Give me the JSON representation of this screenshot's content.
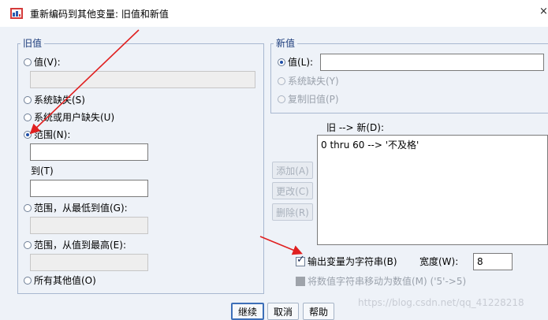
{
  "window": {
    "title": "重新编码到其他变量: 旧值和新值",
    "close_glyph": "×"
  },
  "old_value": {
    "legend": "旧值",
    "value_label": "值(V):",
    "system_missing_label": "系统缺失(S)",
    "system_or_user_missing_label": "系统或用户缺失(U)",
    "range_label": "范围(N):",
    "range_through_label": "到(T)",
    "range_lowest_label": "范围，从最低到值(G):",
    "range_highest_label": "范围，从值到最高(E):",
    "all_other_label": "所有其他值(O)",
    "selected": "range"
  },
  "new_value": {
    "legend": "新值",
    "value_label": "值(L):",
    "system_missing_label": "系统缺失(Y)",
    "copy_old_label": "复制旧值(P)",
    "selected": "value"
  },
  "mapping": {
    "header": "旧 --> 新(D):",
    "items": [
      "0 thru 60 --> '不及格'"
    ]
  },
  "side_buttons": {
    "add": "添加(A)",
    "change": "更改(C)",
    "remove": "删除(R)"
  },
  "output": {
    "as_string_label": "输出变量为字符串(B)",
    "as_string_checked": true,
    "width_label": "宽度(W):",
    "width_value": "8",
    "convert_numeric_label": "将数值字符串移动为数值(M) ('5'->5)"
  },
  "footer": {
    "continue": "继续",
    "cancel": "取消",
    "help": "帮助"
  },
  "watermark": "https://blog.csdn.net/qq_41228218",
  "colors": {
    "background": "#eef2f8",
    "accent_blue": "#1e4ea8",
    "arrow_red": "#e02020",
    "group_border": "#a8b8d0"
  }
}
